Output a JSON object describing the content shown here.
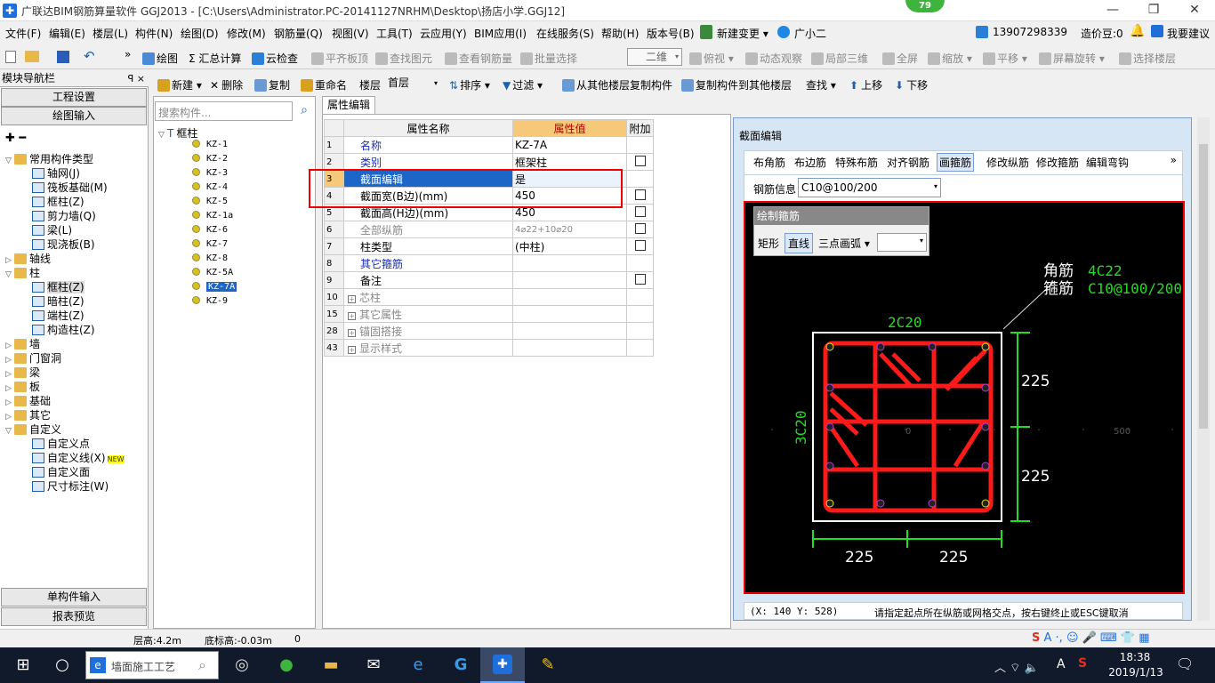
{
  "window": {
    "title": "广联达BIM钢筋算量软件 GGJ2013 - [C:\\Users\\Administrator.PC-20141127NRHM\\Desktop\\扬店小学.GGJ12]",
    "badge": "79",
    "minimize": "—",
    "restore": "❐",
    "close": "✕"
  },
  "menu": {
    "items": [
      "文件(F)",
      "编辑(E)",
      "楼层(L)",
      "构件(N)",
      "绘图(D)",
      "修改(M)",
      "钢筋量(Q)",
      "视图(V)",
      "工具(T)",
      "云应用(Y)",
      "BIM应用(I)",
      "在线服务(S)",
      "帮助(H)",
      "版本号(B)",
      "新建变更 ▾",
      "广小二"
    ],
    "phone": "13907298339",
    "credit": "造价豆:0",
    "feedback": "我要建议"
  },
  "toolbar1": {
    "items": [
      "绘图",
      "Σ 汇总计算",
      "云检查",
      "平齐板顶",
      "查找图元",
      "查看钢筋量",
      "批量选择"
    ],
    "view_mode": "二维",
    "right_items": [
      "俯视 ▾",
      "动态观察",
      "局部三维",
      "全屏",
      "缩放 ▾",
      "平移 ▾",
      "屏幕旋转 ▾",
      "选择楼层"
    ]
  },
  "toolbar2": {
    "items": [
      "新建 ▾",
      "删除",
      "复制",
      "重命名",
      "楼层",
      "首层",
      "排序 ▾",
      "过滤 ▾",
      "从其他楼层复制构件",
      "复制构件到其他楼层",
      "查找 ▾",
      "上移",
      "下移"
    ]
  },
  "nav": {
    "title": "模块导航栏",
    "pin": "ꟼ ×",
    "btn_project": "工程设置",
    "btn_draw": "绘图输入",
    "btn_single": "单构件输入",
    "btn_report": "报表预览",
    "tree": [
      {
        "label": "常用构件类型",
        "level": 0,
        "type": "folder",
        "open": true
      },
      {
        "label": "轴网(J)",
        "level": 1
      },
      {
        "label": "筏板基础(M)",
        "level": 1
      },
      {
        "label": "框柱(Z)",
        "level": 1
      },
      {
        "label": "剪力墙(Q)",
        "level": 1
      },
      {
        "label": "梁(L)",
        "level": 1
      },
      {
        "label": "现浇板(B)",
        "level": 1
      },
      {
        "label": "轴线",
        "level": 0,
        "type": "folder"
      },
      {
        "label": "柱",
        "level": 0,
        "type": "folder",
        "open": true
      },
      {
        "label": "框柱(Z)",
        "level": 1,
        "selected": true
      },
      {
        "label": "暗柱(Z)",
        "level": 1
      },
      {
        "label": "端柱(Z)",
        "level": 1
      },
      {
        "label": "构造柱(Z)",
        "level": 1
      },
      {
        "label": "墙",
        "level": 0,
        "type": "folder"
      },
      {
        "label": "门窗洞",
        "level": 0,
        "type": "folder"
      },
      {
        "label": "梁",
        "level": 0,
        "type": "folder"
      },
      {
        "label": "板",
        "level": 0,
        "type": "folder"
      },
      {
        "label": "基础",
        "level": 0,
        "type": "folder"
      },
      {
        "label": "其它",
        "level": 0,
        "type": "folder"
      },
      {
        "label": "自定义",
        "level": 0,
        "type": "folder",
        "open": true
      },
      {
        "label": "自定义点",
        "level": 1
      },
      {
        "label": "自定义线(X)",
        "level": 1,
        "new": "NEW"
      },
      {
        "label": "自定义面",
        "level": 1
      },
      {
        "label": "尺寸标注(W)",
        "level": 1
      }
    ]
  },
  "components": {
    "search_placeholder": "搜索构件...",
    "root": "框柱",
    "items": [
      "KZ-1",
      "KZ-2",
      "KZ-3",
      "KZ-4",
      "KZ-5",
      "KZ-1a",
      "KZ-6",
      "KZ-7",
      "KZ-8",
      "KZ-5A",
      "KZ-7A",
      "KZ-9"
    ],
    "selected": "KZ-7A"
  },
  "props": {
    "tab": "属性编辑",
    "headers": [
      "属性名称",
      "属性值",
      "附加"
    ],
    "rows": [
      {
        "num": "1",
        "name": "名称",
        "value": "KZ-7A",
        "style": "blue",
        "check": false
      },
      {
        "num": "2",
        "name": "类别",
        "value": "框架柱",
        "style": "blue",
        "check": true
      },
      {
        "num": "3",
        "name": "截面编辑",
        "value": "是",
        "style": "selected",
        "check": false
      },
      {
        "num": "4",
        "name": "截面宽(B边)(mm)",
        "value": "450",
        "style": "",
        "check": true
      },
      {
        "num": "5",
        "name": "截面高(H边)(mm)",
        "value": "450",
        "style": "",
        "check": true
      },
      {
        "num": "6",
        "name": "全部纵筋",
        "value": "4⌀22+10⌀20",
        "style": "gray",
        "check": true
      },
      {
        "num": "7",
        "name": "柱类型",
        "value": "(中柱)",
        "style": "",
        "check": true
      },
      {
        "num": "8",
        "name": "其它箍筋",
        "value": "",
        "style": "blue",
        "check": false
      },
      {
        "num": "9",
        "name": "备注",
        "value": "",
        "style": "",
        "check": true
      },
      {
        "num": "10",
        "name": "芯柱",
        "value": "",
        "style": "gray-plus",
        "check": false
      },
      {
        "num": "15",
        "name": "其它属性",
        "value": "",
        "style": "gray-plus",
        "check": false
      },
      {
        "num": "28",
        "name": "锚固搭接",
        "value": "",
        "style": "gray-plus",
        "check": false
      },
      {
        "num": "43",
        "name": "显示样式",
        "value": "",
        "style": "gray-plus",
        "check": false
      }
    ]
  },
  "section": {
    "title": "截面编辑",
    "tabs": [
      "布角筋",
      "布边筋",
      "特殊布筋",
      "对齐钢筋",
      "画箍筋",
      "修改纵筋",
      "修改箍筋",
      "编辑弯钩"
    ],
    "active_tab": "画箍筋",
    "rebar_label": "钢筋信息",
    "rebar_value": "C10@100/200",
    "draw_title": "绘制箍筋",
    "draw_modes": [
      "矩形",
      "直线",
      "三点画弧 ▾"
    ],
    "active_mode": "直线",
    "corner_label": "角筋",
    "corner_value": "4C22",
    "stirrup_label": "箍筋",
    "stirrup_value": "C10@100/200",
    "top_rebar": "2C20",
    "side_rebar": "3C20",
    "dim_right_1": "225",
    "dim_right_2": "225",
    "dim_bottom_1": "225",
    "dim_bottom_2": "225",
    "grid_0": "0",
    "grid_500": "500",
    "coord": "(X: 140 Y: 528)",
    "hint": "请指定起点所在纵筋或网格交点，按右键终止或ESC键取消"
  },
  "status": {
    "floor_height": "层高:4.2m",
    "bottom_elev": "底标高:-0.03m",
    "value": "0"
  },
  "taskbar": {
    "search": "墙面施工工艺",
    "time": "18:38",
    "date": "2019/1/13",
    "ime": "A"
  },
  "colors": {
    "accent": "#1e6fd9",
    "rebar": "#ff1a1a",
    "dim": "#22dd22",
    "selected_row": "#1c66c8"
  }
}
